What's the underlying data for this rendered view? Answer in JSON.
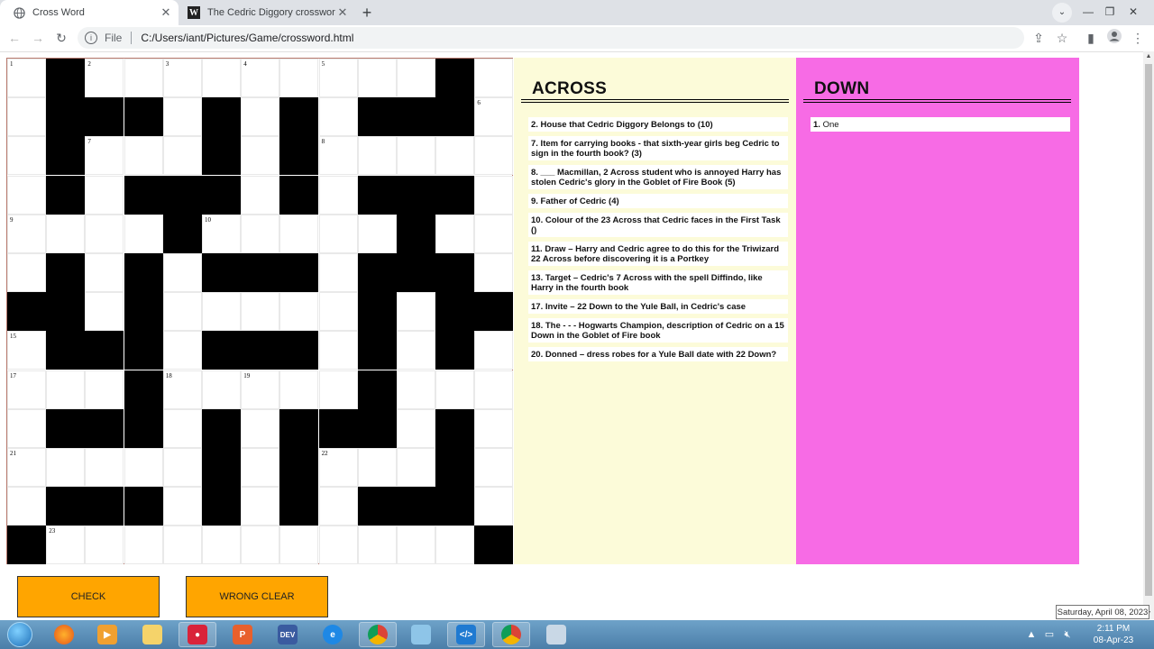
{
  "browser": {
    "tabs": [
      {
        "title": "Cross Word",
        "icon": "globe-icon",
        "active": true
      },
      {
        "title": "The Cedric Diggory crossword | W",
        "icon": "w-logo-icon",
        "active": false
      }
    ],
    "new_tab_label": "+",
    "address": {
      "scheme_label": "File",
      "url": "C:/Users/iant/Pictures/Game/crossword.html"
    }
  },
  "crossword": {
    "size": 13,
    "rows": [
      "#..........#",
      "#...............",
      "#....#.#......",
      "#...#....#..",
      "",
      "",
      "",
      "",
      "",
      "",
      "",
      "",
      ""
    ],
    "layout": [
      ".#.........#.",
      ".###.#.#.###.",
      ".#...#.#.....",
      ".#.###.#.###.",
      "....#.....#..",
      ".#.#.###.###.",
      "##.#.....#.##",
      ".###.###.#.#.",
      "...#.....#...",
      ".###.#.###.#.",
      ".....#.#...#.",
      ".###.#.#.###.",
      "#...........#"
    ],
    "numbers": [
      {
        "r": 0,
        "c": 0,
        "n": "1"
      },
      {
        "r": 0,
        "c": 2,
        "n": "2"
      },
      {
        "r": 0,
        "c": 4,
        "n": "3"
      },
      {
        "r": 0,
        "c": 6,
        "n": "4"
      },
      {
        "r": 0,
        "c": 8,
        "n": "5"
      },
      {
        "r": 1,
        "c": 12,
        "n": "6"
      },
      {
        "r": 2,
        "c": 2,
        "n": "7"
      },
      {
        "r": 2,
        "c": 8,
        "n": "8"
      },
      {
        "r": 4,
        "c": 0,
        "n": "9"
      },
      {
        "r": 4,
        "c": 5,
        "n": "10"
      },
      {
        "r": 4,
        "c": 10,
        "n": "11"
      },
      {
        "r": 7,
        "c": 0,
        "n": "15"
      },
      {
        "r": 8,
        "c": 0,
        "n": "17"
      },
      {
        "r": 8,
        "c": 4,
        "n": "18"
      },
      {
        "r": 8,
        "c": 6,
        "n": "19"
      },
      {
        "r": 8,
        "c": 9,
        "n": "20"
      },
      {
        "r": 10,
        "c": 0,
        "n": "21"
      },
      {
        "r": 10,
        "c": 8,
        "n": "22"
      },
      {
        "r": 12,
        "c": 1,
        "n": "23"
      }
    ]
  },
  "across": {
    "title": "ACROSS",
    "clues": [
      "2. House that Cedric Diggory Belongs to (10)",
      "7. Item for carrying books - that sixth-year girls beg Cedric to sign in the fourth book? (3)",
      "8. ___ Macmillan, 2 Across student who is annoyed Harry has stolen Cedric's glory in the Goblet of Fire Book (5)",
      "9. Father of Cedric (4)",
      "10. Colour of the 23 Across that Cedric faces in the First Task ()",
      "11. Draw – Harry and Cedric agree to do this for the Triwizard 22 Across before discovering it is a Portkey",
      "13. Target – Cedric's 7 Across with the spell Diffindo, like Harry in the fourth book",
      "17. Invite – 22 Down to the Yule Ball, in Cedric's case",
      "18. The - - - Hogwarts Champion, description of Cedric on a 15 Down in the Goblet of Fire book",
      "20. Donned – dress robes for a Yule Ball date with 22 Down?"
    ]
  },
  "down": {
    "title": "DOWN",
    "clues": [
      {
        "num": "1.",
        "text": "One"
      }
    ]
  },
  "buttons": {
    "check": "CHECK",
    "wrong_clear": "WRONG CLEAR"
  },
  "tooltip": "Saturday, April 08, 2023",
  "taskbar": {
    "time": "2:11 PM",
    "date": "08-Apr-23"
  },
  "colors": {
    "across_bg": "#fcfbd9",
    "down_bg": "#f76be5",
    "button_bg": "#ffa500"
  }
}
